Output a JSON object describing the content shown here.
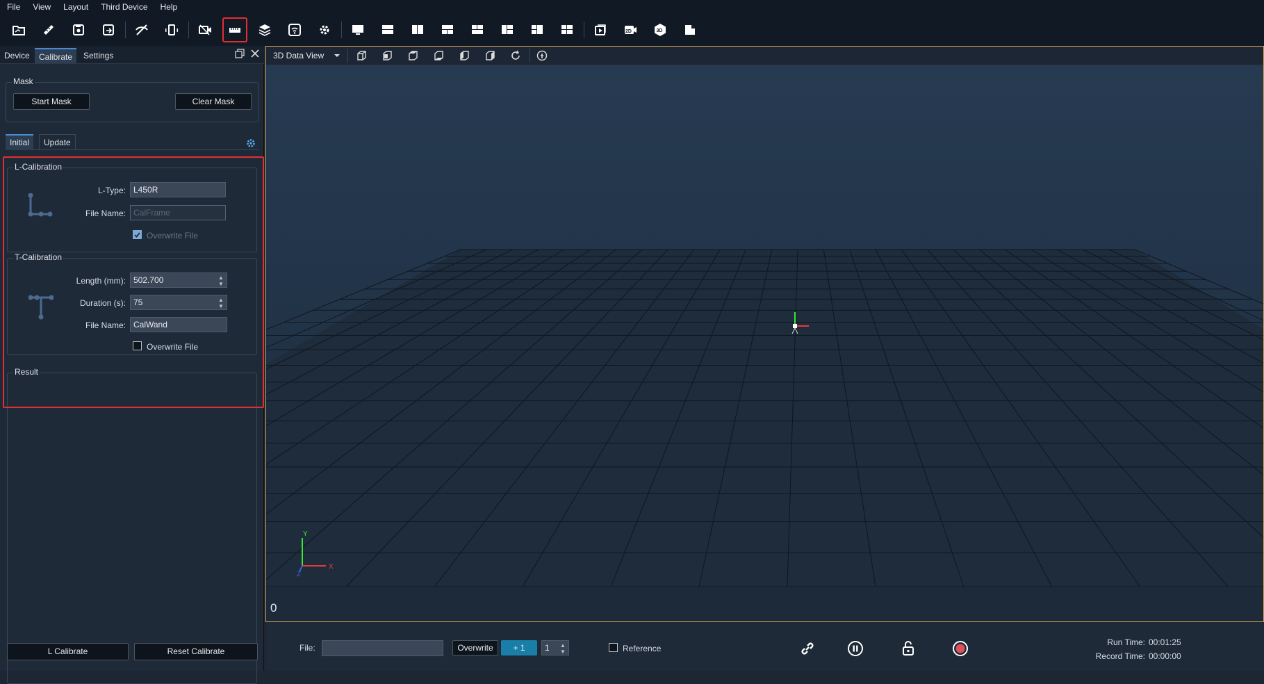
{
  "menu": [
    "File",
    "View",
    "Layout",
    "Third Device",
    "Help"
  ],
  "toolbar_icons": [
    "open-folder-icon",
    "ruler-icon",
    "save-icon",
    "save-as-icon",
    "hide-icon",
    "rotate-device-icon",
    "camera-off-icon",
    "calibrate-ruler-icon",
    "layers-icon",
    "wireless-icon",
    "gear-icon",
    "layout-single-icon",
    "layout-split-h-icon",
    "layout-split-v-icon",
    "layout-grid-icon",
    "layout-triple-icon",
    "layout-left-icon",
    "layout-right-icon",
    "layout-quad-icon",
    "playback-icon",
    "2d-view-icon",
    "3d-view-icon",
    "document-icon"
  ],
  "left_tabs": {
    "device": "Device",
    "calibrate": "Calibrate",
    "settings": "Settings"
  },
  "mask": {
    "title": "Mask",
    "start": "Start Mask",
    "clear": "Clear Mask"
  },
  "sub_tabs": {
    "initial": "Initial",
    "update": "Update"
  },
  "l_cal": {
    "title": "L-Calibration",
    "ltype_label": "L-Type:",
    "ltype_value": "L450R",
    "file_label": "File Name:",
    "file_placeholder": "CalFrame",
    "overwrite_label": "Overwrite File",
    "overwrite_checked": true
  },
  "t_cal": {
    "title": "T-Calibration",
    "length_label": "Length (mm):",
    "length_value": "502.700",
    "duration_label": "Duration (s):",
    "duration_value": "75",
    "file_label": "File Name:",
    "file_value": "CalWand",
    "overwrite_label": "Overwrite File",
    "overwrite_checked": false
  },
  "result": {
    "title": "Result"
  },
  "bottom_buttons": {
    "l_calibrate": "L Calibrate",
    "reset": "Reset Calibrate"
  },
  "view": {
    "mode": "3D Data View",
    "frame": "0",
    "axis_x": "X",
    "axis_y": "Y",
    "axis_z": "Z"
  },
  "record": {
    "file_label": "File:",
    "file_value": "",
    "overwrite": "Overwrite",
    "plus_one": "+ 1",
    "counter": "1",
    "reference": "Reference",
    "run_time_label": "Run Time:",
    "run_time": "00:01:25",
    "record_time_label": "Record Time:",
    "record_time": "00:00:00"
  },
  "colors": {
    "accent": "#4b8ad2",
    "highlight": "#e03030",
    "record": "#e0505a",
    "view_border": "#d6a35a"
  }
}
